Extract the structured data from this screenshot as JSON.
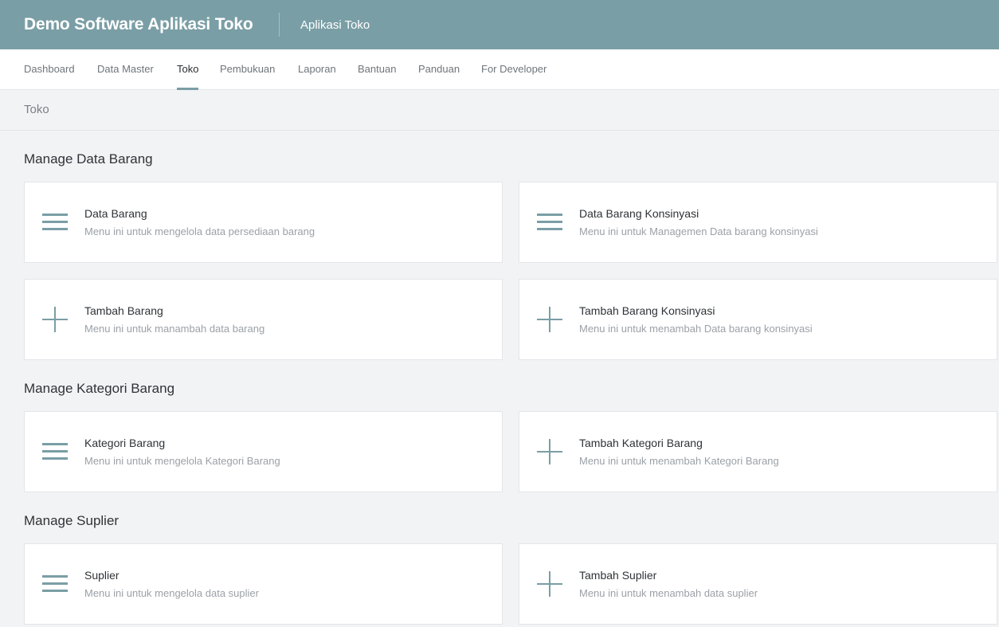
{
  "header": {
    "brand": "Demo Software Aplikasi Toko",
    "app_name": "Aplikasi Toko"
  },
  "nav": {
    "items": [
      "Dashboard",
      "Data Master",
      "Toko",
      "Pembukuan",
      "Laporan",
      "Bantuan",
      "Panduan",
      "For Developer"
    ],
    "active": "Toko"
  },
  "breadcrumb": "Toko",
  "sections": [
    {
      "title": "Manage Data Barang",
      "cards": [
        {
          "icon": "menu-icon",
          "title": "Data Barang",
          "desc": "Menu ini untuk mengelola data persediaan barang"
        },
        {
          "icon": "menu-icon",
          "title": "Data Barang Konsinyasi",
          "desc": "Menu ini untuk Managemen Data barang konsinyasi"
        },
        {
          "icon": "plus-icon",
          "title": "Tambah Barang",
          "desc": "Menu ini untuk manambah data barang"
        },
        {
          "icon": "plus-icon",
          "title": "Tambah Barang Konsinyasi",
          "desc": "Menu ini untuk menambah Data barang konsinyasi"
        }
      ]
    },
    {
      "title": "Manage Kategori Barang",
      "cards": [
        {
          "icon": "menu-icon",
          "title": "Kategori Barang",
          "desc": "Menu ini untuk mengelola Kategori Barang"
        },
        {
          "icon": "plus-icon",
          "title": "Tambah Kategori Barang",
          "desc": "Menu ini untuk menambah Kategori Barang"
        }
      ]
    },
    {
      "title": "Manage Suplier",
      "cards": [
        {
          "icon": "menu-icon",
          "title": "Suplier",
          "desc": "Menu ini untuk mengelola data suplier"
        },
        {
          "icon": "plus-icon",
          "title": "Tambah Suplier",
          "desc": "Menu ini untuk menambah data suplier"
        }
      ]
    }
  ],
  "colors": {
    "accent": "#7a9ea5",
    "background": "#f2f3f5",
    "icon": "#7a9ea5"
  }
}
